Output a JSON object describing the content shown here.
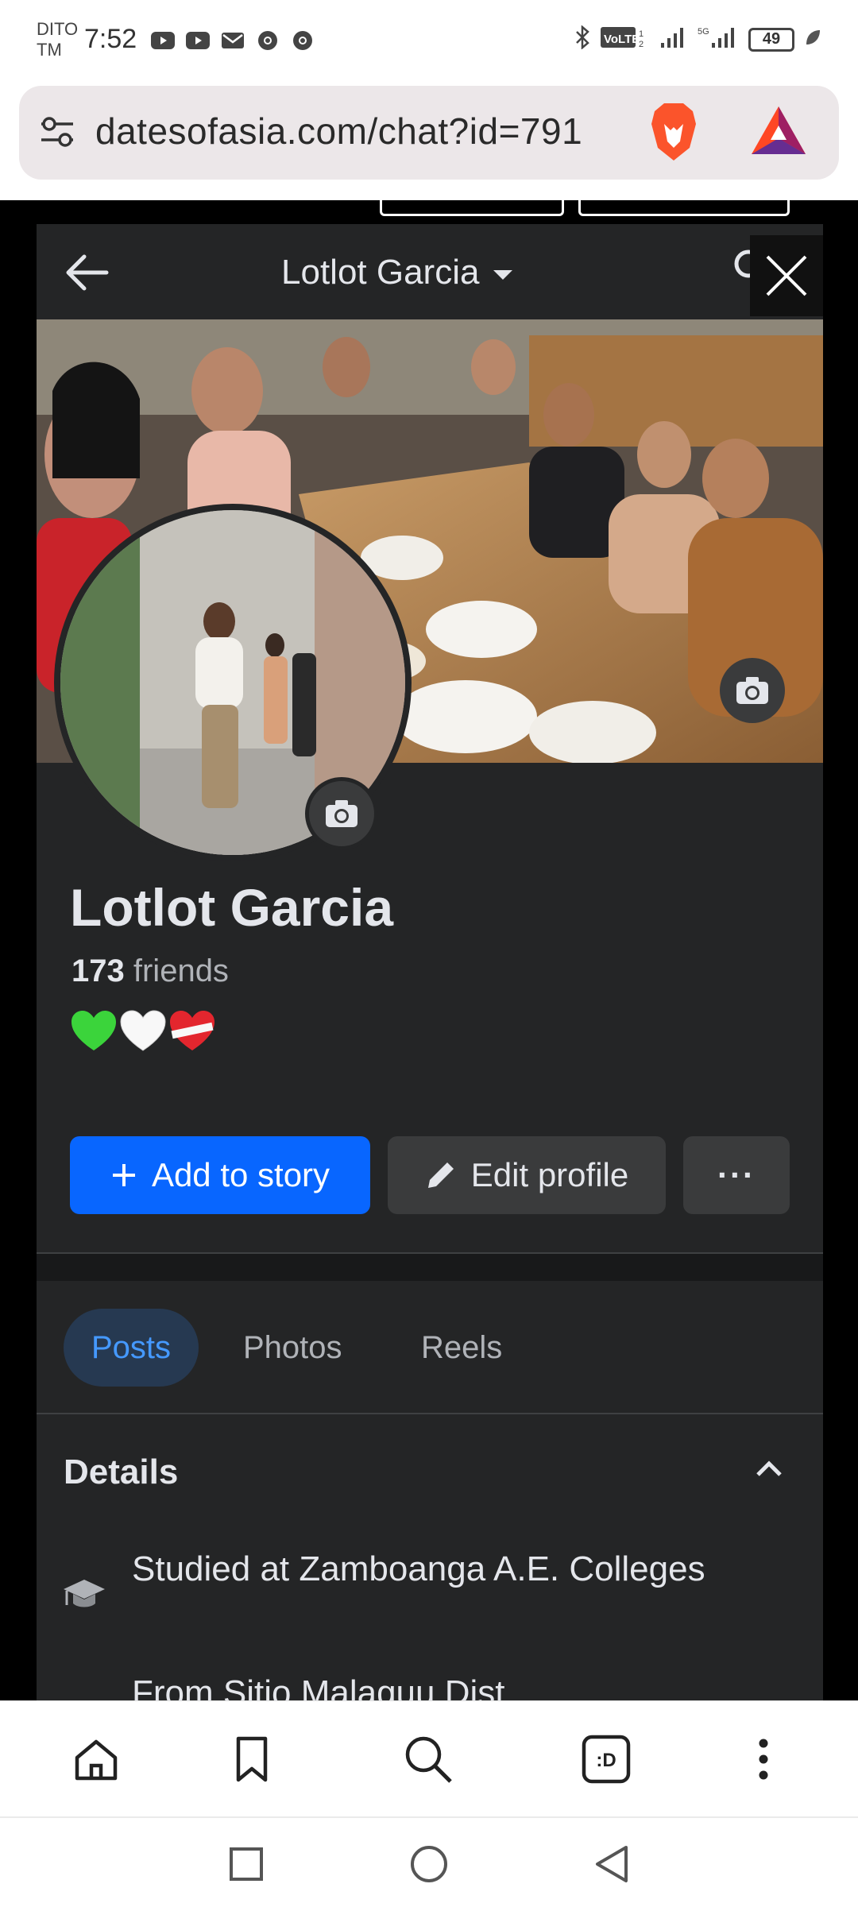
{
  "status_bar": {
    "carrier_line1": "DITO",
    "carrier_line2": "TM",
    "time": "7:52",
    "battery": "49",
    "icons_left": [
      "youtube-icon",
      "youtube-icon",
      "mail-icon",
      "chrome-icon",
      "chrome-icon"
    ],
    "icons_right": [
      "bluetooth-icon",
      "volte-icon",
      "signal-icon",
      "5g-signal-icon",
      "battery-icon",
      "leaf-icon"
    ]
  },
  "browser": {
    "url": "datesofasia.com/chat?id=791",
    "toolbar": [
      "home-icon",
      "bookmark-icon",
      "search-icon",
      "tabs-icon",
      "more-icon"
    ],
    "tabs_label": ":D"
  },
  "profile": {
    "header_title": "Lotlot Garcia",
    "name": "Lotlot Garcia",
    "friends_count": "173",
    "friends_label": "friends",
    "bio": "💚🤍❤️‍🩹",
    "add_story_label": "Add to story",
    "edit_profile_label": "Edit profile",
    "more_label": "···",
    "tabs": [
      {
        "label": "Posts",
        "active": true
      },
      {
        "label": "Photos",
        "active": false
      },
      {
        "label": "Reels",
        "active": false
      }
    ],
    "details_title": "Details",
    "education": "Studied at Zamboanga A.E. Colleges",
    "next_detail_partial": "From Sitio Malaguu Dist..."
  },
  "colors": {
    "accent": "#0866ff",
    "dark_bg": "#242526",
    "tab_active_bg": "#263951",
    "tab_active_text": "#4599ff"
  }
}
